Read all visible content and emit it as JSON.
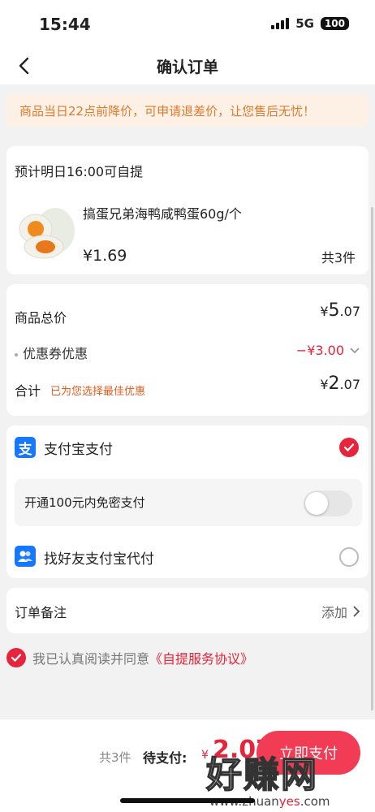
{
  "status": {
    "time": "15:44",
    "network": "5G",
    "battery": "100"
  },
  "nav": {
    "title": "确认订单"
  },
  "notice": {
    "text": "商品当日22点前降价，可申请退差价，让您售后无忧！"
  },
  "pickup": {
    "time_text": "预计明日16:00可自提",
    "product_name": "搞蛋兄弟海鸭咸鸭蛋60g/个",
    "price": "¥1.69",
    "quantity": "共3件"
  },
  "summary": {
    "goods_total_label": "商品总价",
    "goods_total_yen": "¥",
    "goods_total_int": "5",
    "goods_total_dec": ".07",
    "coupon_label": "优惠券优惠",
    "coupon_value": "−¥3.00",
    "total_label": "合计",
    "total_note": "已为您选择最佳优惠",
    "total_yen": "¥",
    "total_int": "2",
    "total_dec": ".07"
  },
  "payment": {
    "alipay_icon": "支",
    "alipay_label": "支付宝支付",
    "nopass_label": "开通100元内免密支付",
    "friend_label": "找好友支付宝代付"
  },
  "remark": {
    "label": "订单备注",
    "action": "添加"
  },
  "agreement": {
    "text": "我已认真阅读并同意",
    "link": "《自提服务协议》"
  },
  "bottom": {
    "count": "共3件",
    "due_label": "待支付:",
    "yen": "¥",
    "amount": "2.07",
    "pay_button": "立即支付"
  },
  "watermark": {
    "main": "好赚网",
    "sub_prefix": "www.zhuan",
    "sub_mid": "yes",
    "sub_suffix": ".com"
  },
  "colors": {
    "accent": "#e6243c",
    "notice": "#e07b2e",
    "alipay": "#1677ff"
  }
}
